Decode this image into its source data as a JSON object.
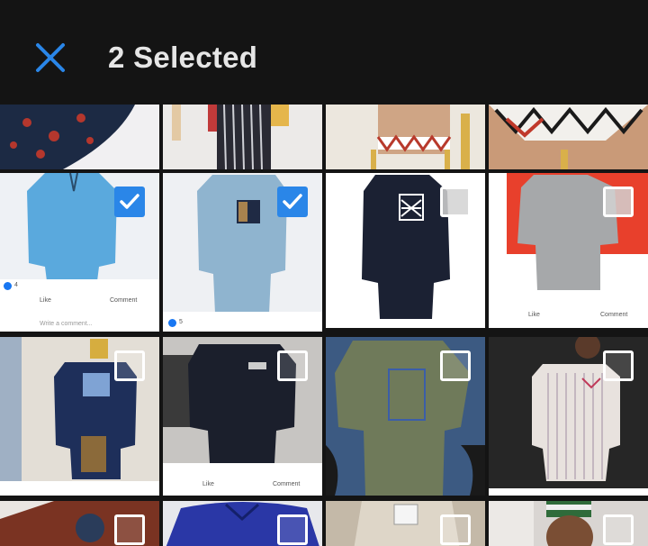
{
  "header": {
    "title": "2 Selected",
    "close_icon": "close-icon",
    "accent_color": "#2a86e8"
  },
  "grid": {
    "selected_count": 2,
    "fb_like": "Like",
    "fb_comment": "Comment",
    "fb_write": "Write a comment...",
    "reaction_a": "4",
    "reaction_b": "5"
  }
}
